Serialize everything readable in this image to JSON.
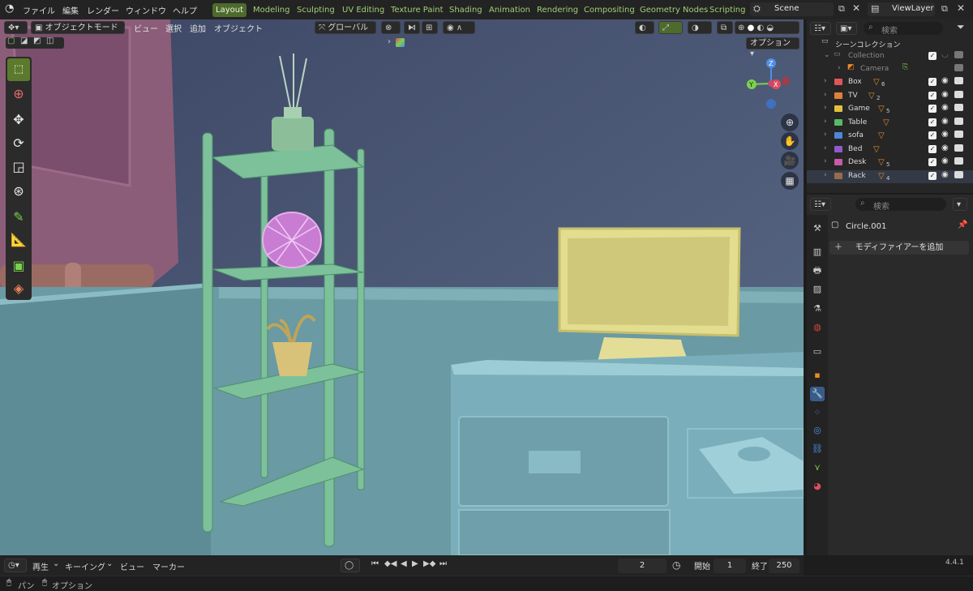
{
  "menubar": {
    "items": [
      "ファイル",
      "編集",
      "レンダー",
      "ウィンドウ",
      "ヘルプ"
    ],
    "workspaces": [
      "Layout",
      "Modeling",
      "Sculpting",
      "UV Editing",
      "Texture Paint",
      "Shading",
      "Animation",
      "Rendering",
      "Compositing",
      "Geometry Nodes",
      "Scripting"
    ],
    "active_workspace": "Layout",
    "scene": "Scene",
    "view_layer": "ViewLayer"
  },
  "viewport_header": {
    "mode": "オブジェクトモード",
    "menus": [
      "ビュー",
      "選択",
      "追加",
      "オブジェクト"
    ],
    "orientation": "グローバル",
    "options": "オプション"
  },
  "toolbar": {
    "tools": [
      "select-box",
      "cursor",
      "move",
      "rotate",
      "scale",
      "transform",
      "annotate",
      "measure",
      "add-cube",
      "transform-origin"
    ]
  },
  "outliner": {
    "search_placeholder": "検索",
    "root": "シーンコレクション",
    "collection": "Collection",
    "camera": "Camera",
    "items": [
      {
        "name": "Box",
        "color": "#e05656",
        "count": "6"
      },
      {
        "name": "TV",
        "color": "#e0803a",
        "count": "2"
      },
      {
        "name": "Game",
        "color": "#e2c23c",
        "count": "5"
      },
      {
        "name": "Table",
        "color": "#58b866",
        "count": ""
      },
      {
        "name": "sofa",
        "color": "#4f86d8",
        "count": ""
      },
      {
        "name": "Bed",
        "color": "#8f5ad0",
        "count": ""
      },
      {
        "name": "Desk",
        "color": "#c65ca5",
        "count": "5"
      },
      {
        "name": "Rack",
        "color": "#9a6b4a",
        "count": "4"
      }
    ]
  },
  "properties": {
    "search_placeholder": "検索",
    "object_name": "Circle.001",
    "add_modifier": "モディファイアーを追加"
  },
  "timeline": {
    "menus": [
      "再生",
      "キーイング",
      "ビュー",
      "マーカー"
    ],
    "current_frame": "2",
    "start_label": "開始",
    "start": "1",
    "end_label": "終了",
    "end": "250"
  },
  "status_bar": {
    "left": [
      "パン",
      "オプション"
    ],
    "version": "4.4.1"
  },
  "colors": {
    "active_tab": "#4e6a2c",
    "accent": "#f0a000",
    "gizmo_x": "#e04c5c",
    "gizmo_y": "#7bd14c",
    "gizmo_z": "#4f8ee8"
  }
}
